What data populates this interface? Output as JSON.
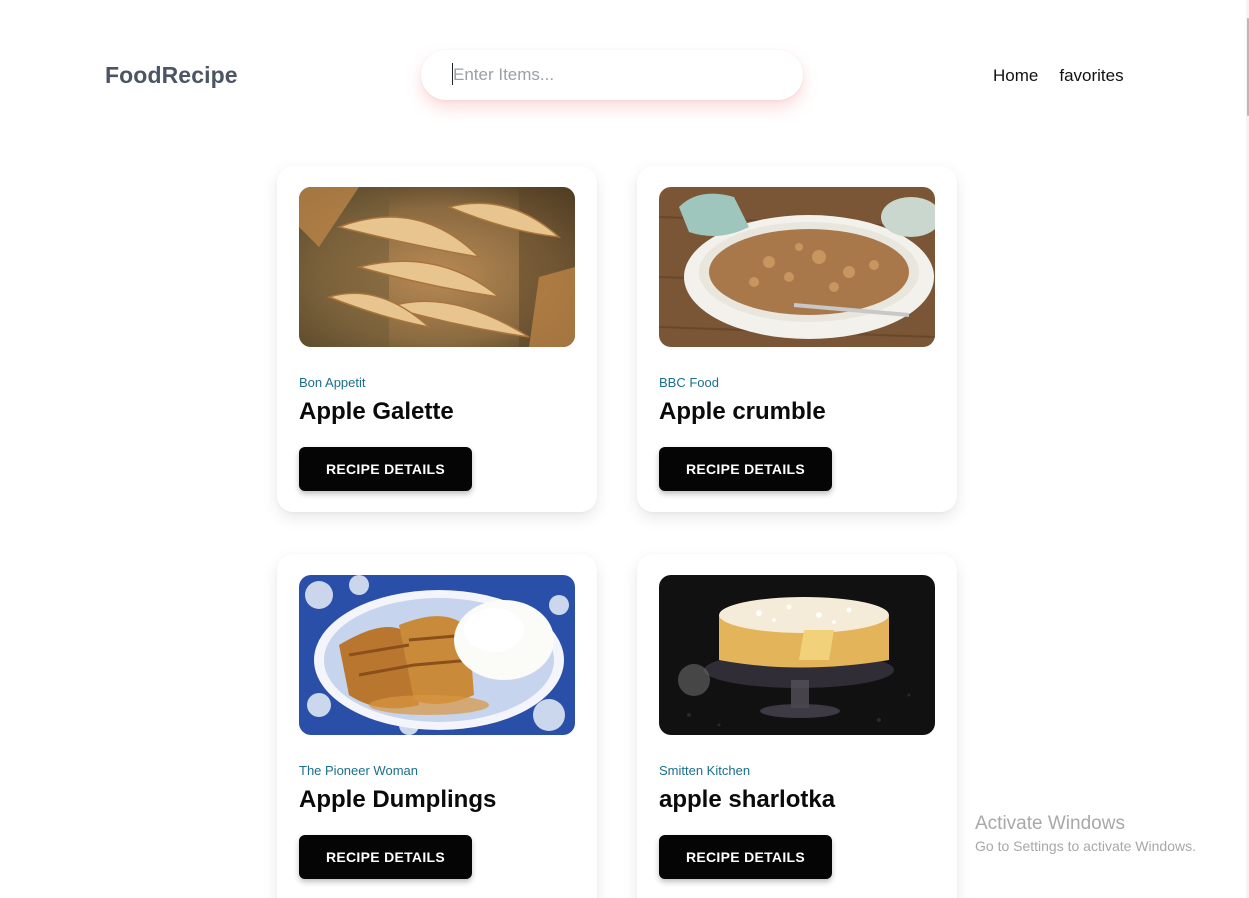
{
  "header": {
    "brand": "FoodRecipe",
    "search": {
      "placeholder": "Enter Items...",
      "value": ""
    },
    "nav": {
      "home": "Home",
      "favorites": "favorites"
    }
  },
  "recipes": [
    {
      "publisher": "Bon Appetit",
      "title": "Apple Galette",
      "button": "RECIPE DETAILS",
      "image": "apple-galette-photo"
    },
    {
      "publisher": "BBC Food",
      "title": "Apple crumble",
      "button": "RECIPE DETAILS",
      "image": "apple-crumble-photo"
    },
    {
      "publisher": "The Pioneer Woman",
      "title": "Apple Dumplings",
      "button": "RECIPE DETAILS",
      "image": "apple-dumplings-photo"
    },
    {
      "publisher": "Smitten Kitchen",
      "title": "apple sharlotka",
      "button": "RECIPE DETAILS",
      "image": "apple-sharlotka-photo"
    }
  ],
  "watermark": {
    "title": "Activate Windows",
    "subtitle": "Go to Settings to activate Windows."
  },
  "colors": {
    "brand": "#4b5563",
    "publisher": "#1b6f8c",
    "button_bg": "#050505",
    "button_text": "#ffffff",
    "search_shadow": "#f88282"
  }
}
